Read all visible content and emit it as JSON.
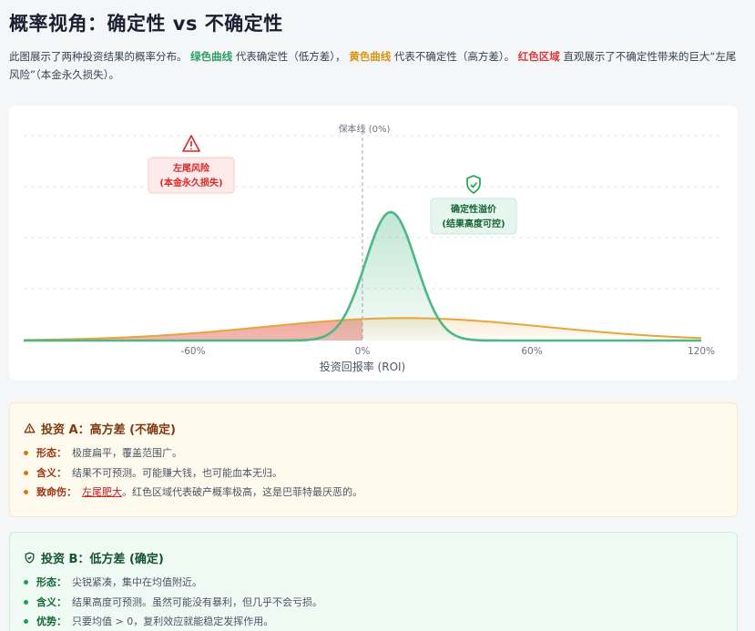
{
  "header": {
    "title": "概率视角：确定性 vs 不确定性",
    "desc_prefix": "此图展示了两种投资结果的概率分布。",
    "desc_green": "绿色曲线",
    "desc_mid1": "代表确定性（低方差），",
    "desc_yellow": "黄色曲线",
    "desc_mid2": "代表不确定性（高方差）。",
    "desc_red": "红色区域",
    "desc_suffix": "直观展示了不确定性带来的巨大“左尾风险”（本金永久损失）。"
  },
  "colors": {
    "green": "#4cb886",
    "yellow": "#e9a43a",
    "red": "#e25555"
  },
  "chart_data": {
    "type": "area",
    "xlabel": "投资回报率 (ROI)",
    "xlim": [
      -120,
      120
    ],
    "xticks": [
      -60,
      0,
      60,
      120
    ],
    "xtick_labels": [
      "-60%",
      "0%",
      "60%",
      "120%"
    ],
    "vline": {
      "x": 0,
      "label": "保本线 (0%)"
    },
    "grid": true,
    "series": [
      {
        "kind": "certain",
        "shape": "normal",
        "mean": 10,
        "std": 9,
        "peak": 1.0
      },
      {
        "kind": "uncertain",
        "shape": "normal",
        "mean": 15,
        "std": 50,
        "peak": 0.175
      }
    ],
    "shaded_region": {
      "series": 1,
      "from": -120,
      "to": 0
    },
    "annotations": [
      {
        "icon": "warning-icon",
        "line1": "左尾风险",
        "line2": "(本金永久损失)"
      },
      {
        "icon": "shield-check-icon",
        "line1": "确定性溢价",
        "line2": "(结果高度可控)"
      }
    ]
  },
  "box_a": {
    "title": "投资 A：高方差 (不确定)",
    "items": [
      {
        "key": "形态：",
        "text": "极度扁平，覆盖范围广。"
      },
      {
        "key": "含义：",
        "text": "结果不可预测。可能赚大钱，也可能血本无归。"
      },
      {
        "key": "致命伤：",
        "text_u": "左尾肥大",
        "text": "。红色区域代表破产概率极高，这是巴菲特最厌恶的。"
      }
    ]
  },
  "box_b": {
    "title": "投资 B：低方差 (确定)",
    "items": [
      {
        "key": "形态：",
        "text": "尖锐紧凑，集中在均值附近。"
      },
      {
        "key": "含义：",
        "text": "结果高度可预测。虽然可能没有暴利，但几乎不会亏损。"
      },
      {
        "key": "优势：",
        "text": "只要均值 > 0，复利效应就能稳定发挥作用。"
      }
    ]
  }
}
